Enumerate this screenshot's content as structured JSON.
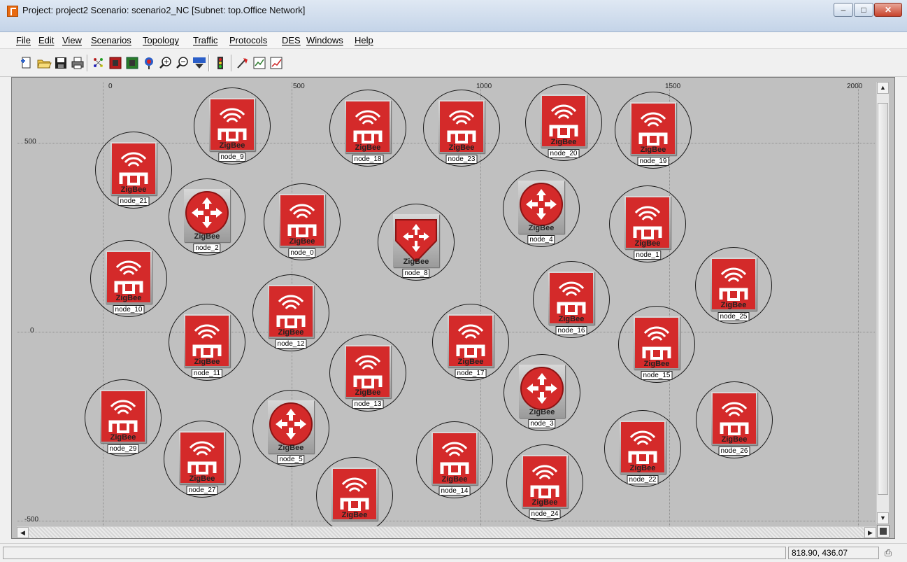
{
  "window": {
    "title": "Project: project2 Scenario: scenario2_NC  [Subnet: top.Office Network]",
    "minimize_label": "–",
    "maximize_label": "□",
    "close_label": "✕"
  },
  "menu": [
    "File",
    "Edit",
    "View",
    "Scenarios",
    "Topology",
    "Traffic",
    "Protocols",
    "DES",
    "Windows",
    "Help"
  ],
  "toolbar": [
    "new-project-icon",
    "open-icon",
    "save-icon",
    "print-icon",
    "deploy-icon",
    "configure-icon",
    "verify-icon",
    "checkpoint-icon",
    "zoom-in-icon",
    "zoom-out-icon",
    "ace-icon",
    "run-simulation-icon",
    "failure-icon",
    "results-icon",
    "graph-icon"
  ],
  "canvas": {
    "x_ticks": [
      "0",
      "500",
      "1000",
      "1500",
      "2000"
    ],
    "y_ticks": [
      "500",
      "0",
      "-500"
    ],
    "node_type_label": "ZigBee",
    "nodes": [
      {
        "name": "node_9",
        "type": "end"
      },
      {
        "name": "node_18",
        "type": "end"
      },
      {
        "name": "node_23",
        "type": "end"
      },
      {
        "name": "node_20",
        "type": "end"
      },
      {
        "name": "node_19",
        "type": "end"
      },
      {
        "name": "node_21",
        "type": "end"
      },
      {
        "name": "node_2",
        "type": "router"
      },
      {
        "name": "node_0",
        "type": "end"
      },
      {
        "name": "node_8",
        "type": "coordinator"
      },
      {
        "name": "node_4",
        "type": "router"
      },
      {
        "name": "node_1",
        "type": "end"
      },
      {
        "name": "node_10",
        "type": "end"
      },
      {
        "name": "node_12",
        "type": "end"
      },
      {
        "name": "node_16",
        "type": "end"
      },
      {
        "name": "node_25",
        "type": "end"
      },
      {
        "name": "node_11",
        "type": "end"
      },
      {
        "name": "node_17",
        "type": "end"
      },
      {
        "name": "node_15",
        "type": "end"
      },
      {
        "name": "node_13",
        "type": "end"
      },
      {
        "name": "node_3",
        "type": "router"
      },
      {
        "name": "node_29",
        "type": "end"
      },
      {
        "name": "node_5",
        "type": "router"
      },
      {
        "name": "node_27",
        "type": "end"
      },
      {
        "name": "node_14",
        "type": "end"
      },
      {
        "name": "node_22",
        "type": "end"
      },
      {
        "name": "node_26",
        "type": "end"
      },
      {
        "name": "node_24",
        "type": "end"
      },
      {
        "name": "",
        "type": "end"
      }
    ]
  },
  "colors": {
    "node_red": "#d42a2a",
    "canvas_bg": "#c0c0c0"
  },
  "status": {
    "coords": "818.90, 436.07",
    "status_icon": "⎙"
  }
}
